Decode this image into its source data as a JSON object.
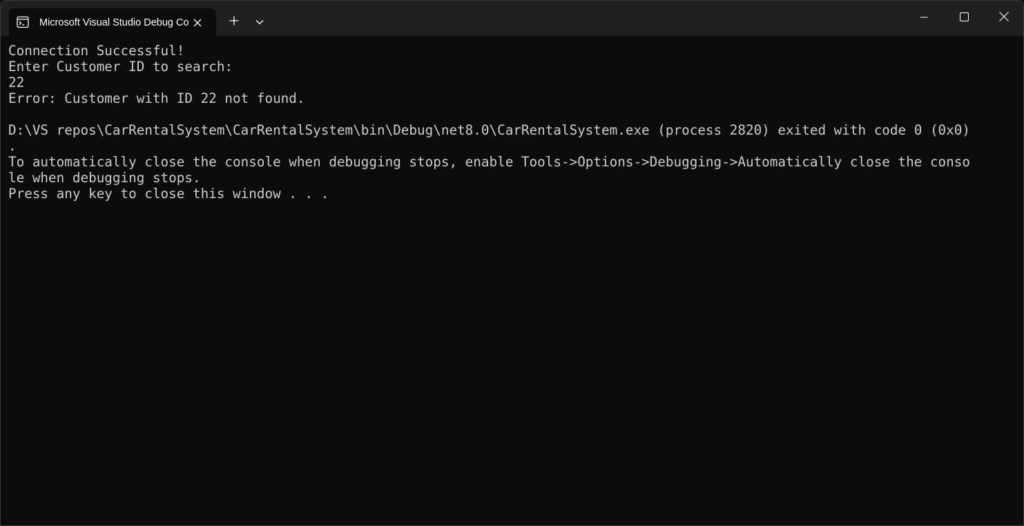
{
  "window": {
    "tab_title": "Microsoft Visual Studio Debug Console",
    "tab_icon": "console-app-icon",
    "new_tab_icon": "plus-icon",
    "dropdown_icon": "chevron-down-icon",
    "controls": {
      "minimize_icon": "minimize-icon",
      "maximize_icon": "maximize-icon",
      "close_icon": "close-icon"
    }
  },
  "colors": {
    "titlebar": "#202020",
    "console_background": "#0c0c0c",
    "console_text": "#cccccc",
    "tab_text": "#ffffff"
  },
  "console": {
    "lines": [
      "Connection Successful!",
      "Enter Customer ID to search:",
      "22",
      "Error: Customer with ID 22 not found.",
      "",
      "D:\\VS repos\\CarRentalSystem\\CarRentalSystem\\bin\\Debug\\net8.0\\CarRentalSystem.exe (process 2820) exited with code 0 (0x0)",
      ".",
      "To automatically close the console when debugging stops, enable Tools->Options->Debugging->Automatically close the conso",
      "le when debugging stops.",
      "Press any key to close this window . . ."
    ]
  }
}
